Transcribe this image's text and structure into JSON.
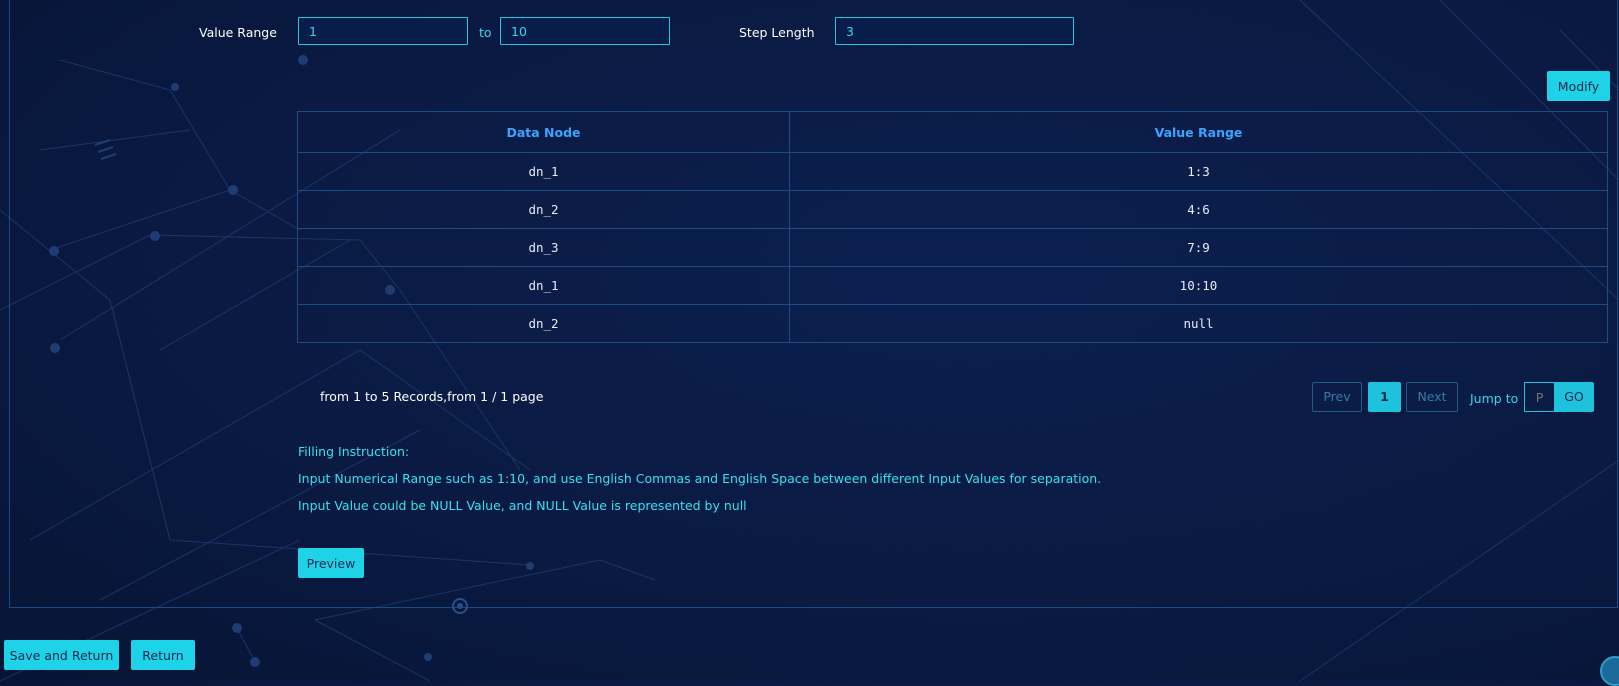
{
  "form": {
    "value_range_label": "Value Range",
    "range_from": "1",
    "range_to_label": "to",
    "range_to": "10",
    "step_length_label": "Step Length",
    "step_length": "3",
    "modify_label": "Modify"
  },
  "table": {
    "headers": [
      "Data Node",
      "Value Range"
    ],
    "rows": [
      {
        "node": "dn_1",
        "range": "1:3"
      },
      {
        "node": "dn_2",
        "range": "4:6"
      },
      {
        "node": "dn_3",
        "range": "7:9"
      },
      {
        "node": "dn_1",
        "range": "10:10"
      },
      {
        "node": "dn_2",
        "range": "null"
      }
    ]
  },
  "pagination": {
    "info": "from 1 to 5 Records,from 1 / 1 page",
    "prev_label": "Prev",
    "current_page": "1",
    "next_label": "Next",
    "jump_label": "Jump to",
    "jump_placeholder": "P",
    "go_label": "GO"
  },
  "instructions": {
    "title": "Filling Instruction:",
    "line1": "Input Numerical Range such as 1:10, and use English Commas and English Space between different Input Values for separation.",
    "line2": "Input Value could be NULL Value, and NULL Value is represented by null"
  },
  "preview_label": "Preview",
  "footer": {
    "save_return_label": "Save and Return",
    "return_label": "Return"
  },
  "colors": {
    "background": "#0a1a42",
    "accent": "#1ed2e8",
    "header_text": "#3ba4ff",
    "border": "#1e4a86"
  }
}
